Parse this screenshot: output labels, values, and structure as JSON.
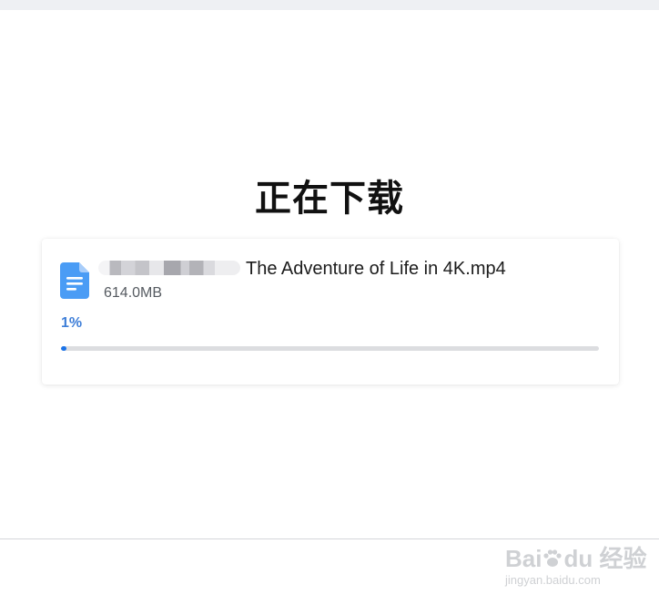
{
  "page": {
    "heading": "正在下载"
  },
  "download": {
    "file_icon": "document-icon",
    "file_name": "The Adventure of Life in 4K.mp4",
    "file_size": "614.0MB",
    "progress_label": "1%",
    "progress_fraction": 0.01
  },
  "watermark": {
    "brand_left": "Bai",
    "brand_right": "du",
    "brand_cn": "经验",
    "url": "jingyan.baidu.com"
  },
  "colors": {
    "accent": "#1a73e8",
    "percent_text": "#3f7fd8",
    "file_icon": "#4a9cf5",
    "track": "#dcdde0"
  }
}
